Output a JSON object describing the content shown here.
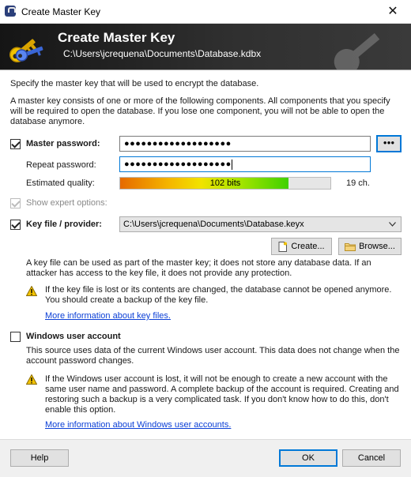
{
  "window": {
    "title": "Create Master Key",
    "close_glyph": "✕"
  },
  "banner": {
    "heading": "Create Master Key",
    "path": "C:\\Users\\jcrequena\\Documents\\Database.kdbx"
  },
  "intro": {
    "line1": "Specify the master key that will be used to encrypt the database.",
    "para": "A master key consists of one or more of the following components. All components that you specify will be required to open the database. If you lose one component, you will not be able to open the database anymore."
  },
  "master_password": {
    "label": "Master password:",
    "checked": true,
    "value": "●●●●●●●●●●●●●●●●●●●",
    "toggle_label": "●●●",
    "repeat_label": "Repeat password:",
    "repeat_value": "●●●●●●●●●●●●●●●●●●●",
    "quality_label": "Estimated quality:",
    "quality_text": "102 bits",
    "quality_fraction": 0.8,
    "char_count": "19 ch.",
    "expert_label": "Show expert options:"
  },
  "key_file": {
    "label": "Key file / provider:",
    "checked": true,
    "selected": "C:\\Users\\jcrequena\\Documents\\Database.keyx",
    "create_label": "Create...",
    "browse_label": "Browse...",
    "description": "A key file can be used as part of the master key; it does not store any database data. If an attacker has access to the key file, it does not provide any protection.",
    "warning": "If the key file is lost or its contents are changed, the database cannot be opened anymore. You should create a backup of the key file.",
    "link": "More information about key files."
  },
  "windows_account": {
    "label": "Windows user account",
    "checked": false,
    "description": "This source uses data of the current Windows user account. This data does not change when the account password changes.",
    "warning": "If the Windows user account is lost, it will not be enough to create a new account with the same user name and password. A complete backup of the account is required. Creating and restoring such a backup is a very complicated task. If you don't know how to do this, don't enable this option.",
    "link": "More information about Windows user accounts."
  },
  "footer": {
    "help_label": "Help",
    "ok_label": "OK",
    "cancel_label": "Cancel"
  },
  "icons": {
    "app": "lock-icon",
    "banner": "keys-icon",
    "warning": "warning-icon",
    "create": "new-document-icon",
    "browse": "folder-icon",
    "dropdown": "chevron-down-icon"
  },
  "colors": {
    "link": "#0b3fd6",
    "focus": "#0078d7",
    "banner_bg": "#222222"
  }
}
